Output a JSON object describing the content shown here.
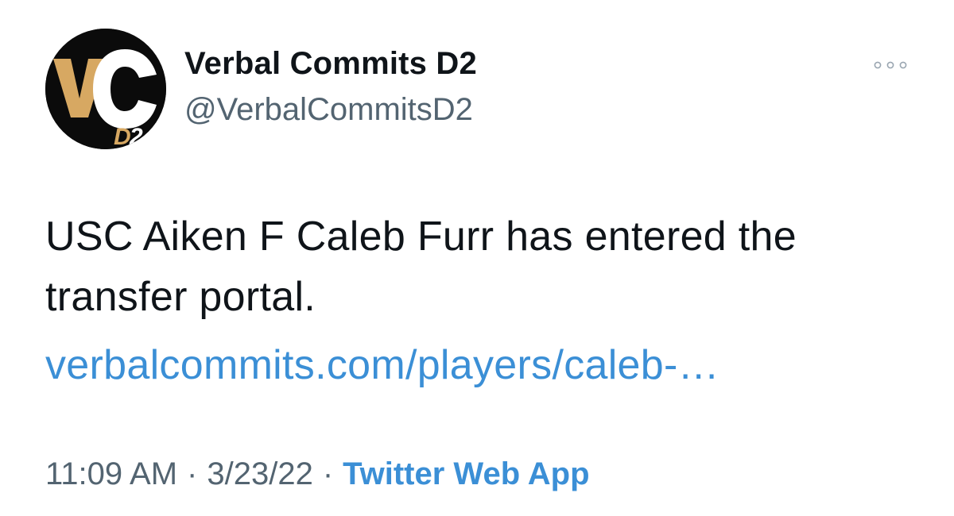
{
  "author": {
    "display_name": "Verbal Commits D2",
    "handle": "@VerbalCommitsD2",
    "avatar": {
      "icon": "verbal-commits-d2-logo",
      "logo_text": "VC",
      "logo_subtext": "D2",
      "colors": {
        "background": "#0b0b0b",
        "gold": "#d7a862",
        "white": "#ffffff"
      }
    }
  },
  "more_icon": "more-horizontal-icon",
  "tweet": {
    "text": "USC Aiken F Caleb Furr has entered the transfer portal.",
    "link_text": "verbalcommits.com/players/caleb-…"
  },
  "meta": {
    "time": "11:09 AM",
    "separator_1": "·",
    "date": "3/23/22",
    "separator_2": "·",
    "source": "Twitter Web App"
  },
  "colors": {
    "text": "#0f1419",
    "secondary": "#536471",
    "link": "#3b8fd6"
  }
}
